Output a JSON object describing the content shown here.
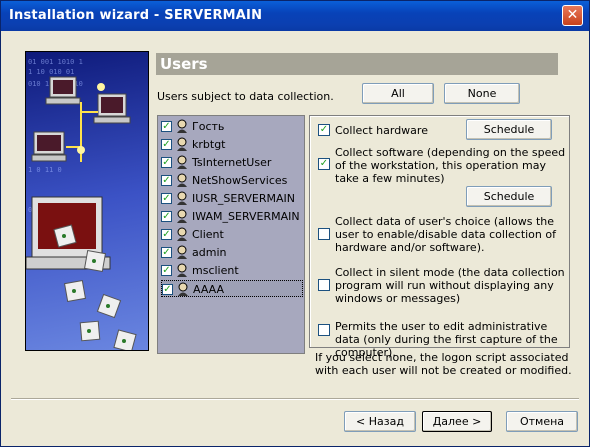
{
  "window": {
    "title": "Installation wizard - SERVERMAIN",
    "close_symbol": "✕"
  },
  "header": {
    "title": "Users"
  },
  "users_label": "Users subject to data collection.",
  "buttons": {
    "all": "All",
    "none": "None",
    "back": "< Назад",
    "next": "Далее >",
    "cancel": "Отмена"
  },
  "users": [
    {
      "name": "Гость",
      "checked": true
    },
    {
      "name": "krbtgt",
      "checked": true
    },
    {
      "name": "TsInternetUser",
      "checked": true
    },
    {
      "name": "NetShowServices",
      "checked": true
    },
    {
      "name": "IUSR_SERVERMAIN",
      "checked": true
    },
    {
      "name": "IWAM_SERVERMAIN",
      "checked": true
    },
    {
      "name": "Client",
      "checked": true
    },
    {
      "name": "admin",
      "checked": true
    },
    {
      "name": "msclient",
      "checked": true
    },
    {
      "name": "AAAA",
      "checked": true,
      "selected": true
    }
  ],
  "options": {
    "collect_hardware": {
      "label": "Collect hardware",
      "checked": true,
      "schedule": "Schedule"
    },
    "collect_software": {
      "label": "Collect software (depending on the speed of the workstation, this operation may take a few minutes)",
      "checked": true,
      "schedule": "Schedule"
    },
    "collect_user_choice": {
      "label": "Collect data of user's choice (allows the user to enable/disable data collection of hardware and/or software).",
      "checked": false
    },
    "silent_mode": {
      "label": "Collect in silent mode (the data collection program will run without displaying any windows or messages)",
      "checked": false
    },
    "edit_admin": {
      "label": "Permits the user to edit administrative data (only during the first capture of the computer).",
      "checked": false
    }
  },
  "note": "If you select none, the logon script associated with each user will not be created or modified."
}
